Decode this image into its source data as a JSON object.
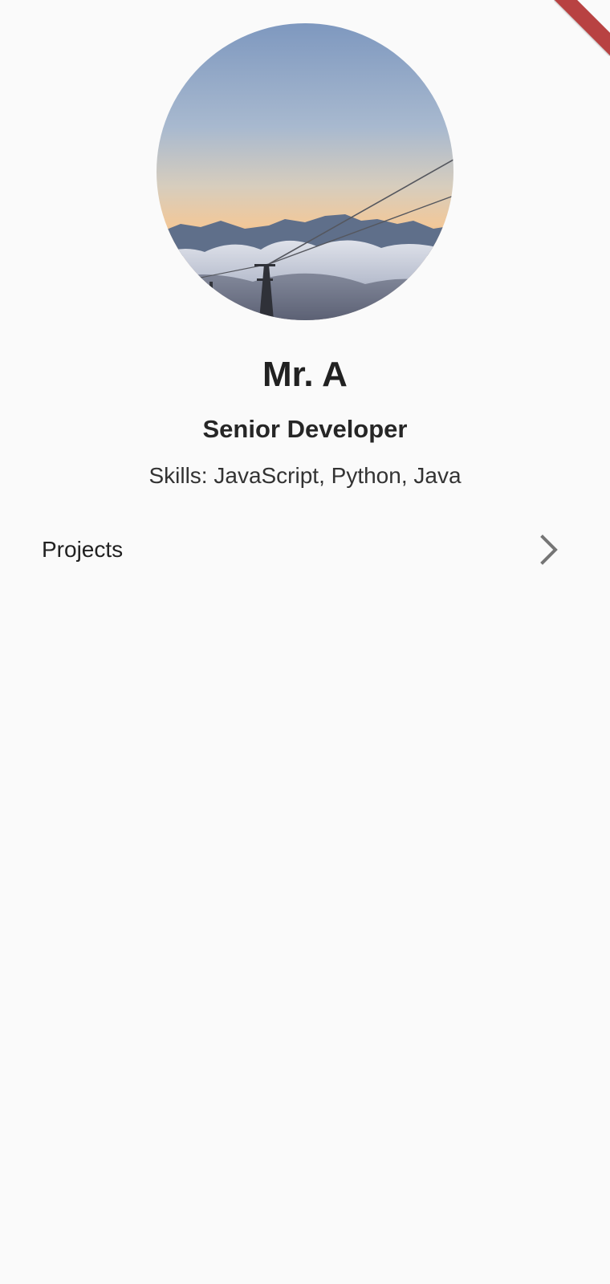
{
  "profile": {
    "name": "Mr. A",
    "role": "Senior Developer",
    "skills": "Skills: JavaScript, Python, Java"
  },
  "menu": {
    "items": [
      {
        "label": "Projects",
        "icon": "chevron-right-icon"
      }
    ]
  },
  "colors": {
    "background": "#fafafa",
    "text_primary": "#212121",
    "icon": "#757575",
    "debug_banner": "#b84242"
  }
}
